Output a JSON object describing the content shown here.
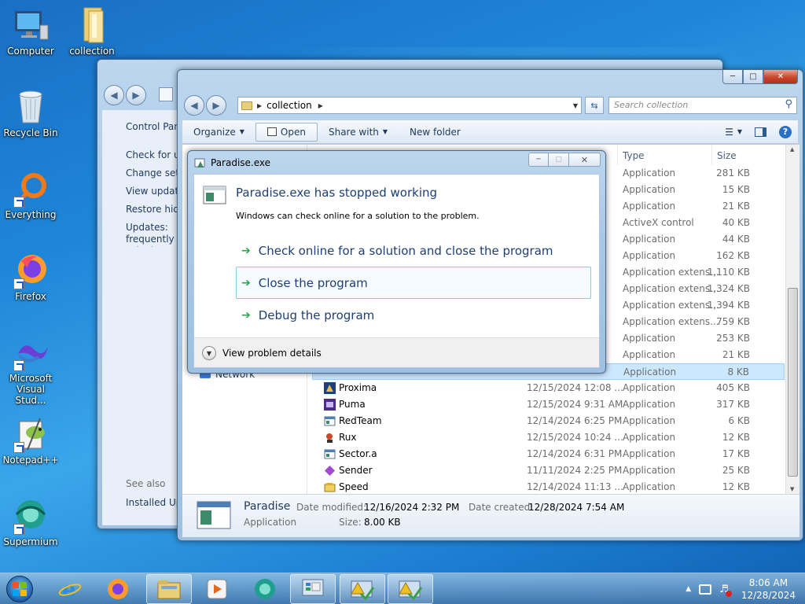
{
  "desktop": {
    "icons": [
      {
        "label": "Computer"
      },
      {
        "label": "collection"
      },
      {
        "label": "Recycle Bin"
      },
      {
        "label": "Everything"
      },
      {
        "label": "Firefox"
      },
      {
        "label": "Microsoft Visual Stud..."
      },
      {
        "label": "Notepad++"
      },
      {
        "label": "Supermium"
      }
    ]
  },
  "back_window": {
    "sidebar": {
      "title": "Control Panel",
      "links": [
        "Check for updates",
        "Change settings",
        "View update history",
        "Restore hidden updates",
        "Updates: frequently asked questions"
      ],
      "see_also": "See also",
      "installed": "Installed Updates"
    }
  },
  "explorer": {
    "breadcrumb": "collection",
    "search_placeholder": "Search collection",
    "toolbar": {
      "organize": "Organize",
      "open": "Open",
      "share_with": "Share with",
      "new_folder": "New folder"
    },
    "columns": {
      "type": "Type",
      "size": "Size"
    },
    "nav_network": "Network",
    "top_rows": [
      {
        "type": "Application",
        "size": "281 KB"
      },
      {
        "type": "Application",
        "size": "15 KB"
      },
      {
        "type": "Application",
        "size": "21 KB"
      },
      {
        "type": "ActiveX control",
        "size": "40 KB"
      },
      {
        "type": "Application",
        "size": "44 KB"
      },
      {
        "type": "Application",
        "size": "162 KB"
      },
      {
        "type": "Application extens...",
        "size": "1,110 KB"
      },
      {
        "type": "Application extens...",
        "size": "1,324 KB"
      },
      {
        "type": "Application extens...",
        "size": "1,394 KB"
      },
      {
        "type": "Application extens...",
        "size": "759 KB"
      },
      {
        "type": "Application",
        "size": "253 KB"
      },
      {
        "type": "Application",
        "size": "21 KB"
      },
      {
        "type": "Application",
        "size": "8 KB"
      }
    ],
    "rows": [
      {
        "name": "Proxima",
        "date": "12/15/2024 12:08 ...",
        "type": "Application",
        "size": "405 KB"
      },
      {
        "name": "Puma",
        "date": "12/15/2024 9:31 AM",
        "type": "Application",
        "size": "317 KB"
      },
      {
        "name": "RedTeam",
        "date": "12/14/2024 6:25 PM",
        "type": "Application",
        "size": "6 KB"
      },
      {
        "name": "Rux",
        "date": "12/15/2024 10:24 ...",
        "type": "Application",
        "size": "12 KB"
      },
      {
        "name": "Sector.a",
        "date": "12/14/2024 6:31 PM",
        "type": "Application",
        "size": "17 KB"
      },
      {
        "name": "Sender",
        "date": "11/11/2024 2:25 PM",
        "type": "Application",
        "size": "25 KB"
      },
      {
        "name": "Speed",
        "date": "12/14/2024 11:13 ...",
        "type": "Application",
        "size": "12 KB"
      }
    ],
    "details": {
      "name": "Paradise",
      "kind": "Application",
      "modified_label": "Date modified:",
      "modified_value": "12/16/2024 2:32 PM",
      "size_label": "Size:",
      "size_value": "8.00 KB",
      "created_label": "Date created:",
      "created_value": "12/28/2024 7:54 AM"
    }
  },
  "dialog": {
    "title": "Paradise.exe",
    "heading": "Paradise.exe has stopped working",
    "message": "Windows can check online for a solution to the problem.",
    "option_check": "Check online for a solution and close the program",
    "option_close": "Close the program",
    "option_debug": "Debug the program",
    "details": "View problem details"
  },
  "taskbar": {
    "time": "8:06 AM",
    "date": "12/28/2024"
  },
  "colors": {
    "link_blue": "#1e3f74",
    "accent_green": "#2aa34a",
    "selection_blue": "#cce8ff"
  }
}
